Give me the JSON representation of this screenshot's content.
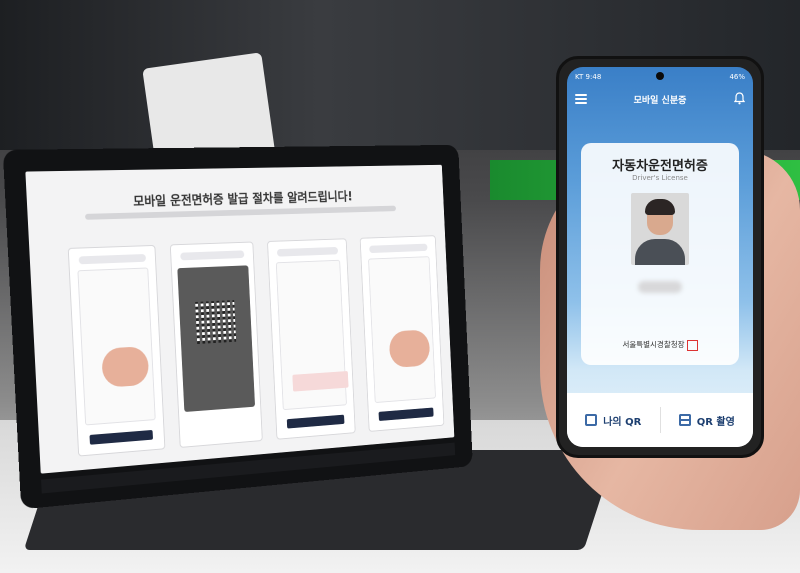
{
  "tablet": {
    "heading": "모바일 운전면허증 발급 절차를 알려드립니다!"
  },
  "phone": {
    "status_left": "KT 9:48",
    "status_right": "46%",
    "app_title": "모바일 신분증",
    "card": {
      "title": "자동차운전면허증",
      "subtitle": "Driver's License",
      "issuer": "서울특별시경찰청장"
    },
    "buttons": {
      "my_qr": "나의 QR",
      "qr_scan": "QR 촬영"
    }
  }
}
